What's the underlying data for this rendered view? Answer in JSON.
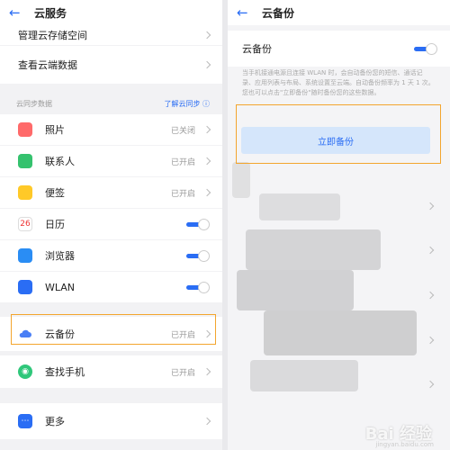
{
  "left": {
    "header_title": "云服务",
    "items_top": [
      {
        "label": "管理云存储空间"
      },
      {
        "label": "查看云端数据"
      }
    ],
    "section_label": "云同步数据",
    "section_link": "了解云同步",
    "items": [
      {
        "label": "照片",
        "status": "已关闭",
        "control": "chevron",
        "icon": "photo-icon",
        "color": "#ff6a6a"
      },
      {
        "label": "联系人",
        "status": "已开启",
        "control": "chevron",
        "icon": "contacts-icon",
        "color": "#35c26e"
      },
      {
        "label": "便签",
        "status": "已开启",
        "control": "chevron",
        "icon": "notes-icon",
        "color": "#ffc928"
      },
      {
        "label": "日历",
        "status": "",
        "control": "toggle",
        "icon": "calendar-icon",
        "color": "#ffffff",
        "icon_text": "26"
      },
      {
        "label": "浏览器",
        "status": "",
        "control": "toggle",
        "icon": "browser-icon",
        "color": "#2a8df4"
      },
      {
        "label": "WLAN",
        "status": "",
        "control": "toggle",
        "icon": "wifi-icon",
        "color": "#2a6df4"
      }
    ],
    "backup_item": {
      "label": "云备份",
      "status": "已开启"
    },
    "find_phone": {
      "label": "查找手机",
      "status": "已开启"
    },
    "more": {
      "label": "更多"
    }
  },
  "right": {
    "header_title": "云备份",
    "backup_toggle_label": "云备份",
    "description": "当手机接通电源且连接 WLAN 时，会自动备份您的短信、通话记录、应用列表与布局、系统设置至云端。自动备份频率为 1 天 1 次。您也可以点击\"立即备份\"随时备份您的这些数据。",
    "button_label": "立即备份"
  },
  "watermark": {
    "text": "Bai 经验",
    "sub": "jingyan.baidu.com"
  },
  "colors": {
    "accent": "#2a6df4",
    "highlight": "#f3a52e"
  }
}
